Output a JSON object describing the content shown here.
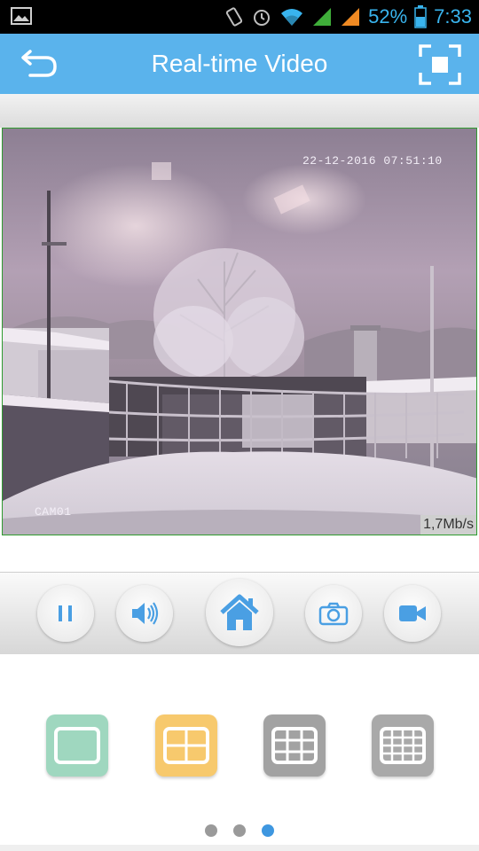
{
  "status_bar": {
    "battery": "52%",
    "time": "7:33",
    "icons": [
      "gallery-icon",
      "vibrate-icon",
      "alarm-icon",
      "wifi-icon",
      "signal-icon",
      "signal-icon",
      "battery-icon"
    ]
  },
  "header": {
    "title": "Real-time Video",
    "back_icon": "back-arrow-icon",
    "fullscreen_icon": "fullscreen-icon"
  },
  "video": {
    "timestamp": "22-12-2016 07:51:10",
    "camera_label": "CAM01",
    "bitrate": "1,7Mb/s"
  },
  "controls": [
    {
      "name": "pause-button",
      "icon": "pause-icon"
    },
    {
      "name": "audio-button",
      "icon": "speaker-icon"
    },
    {
      "name": "home-button",
      "icon": "home-icon"
    },
    {
      "name": "snapshot-button",
      "icon": "camera-icon"
    },
    {
      "name": "record-button",
      "icon": "video-camera-icon"
    }
  ],
  "layout_options": [
    {
      "name": "single-view",
      "color": "#9fd7bf"
    },
    {
      "name": "quad-view",
      "color": "#f7c96d"
    },
    {
      "name": "nine-view",
      "color": "#a2a2a2"
    },
    {
      "name": "sixteen-view",
      "color": "#a9a9a9"
    }
  ],
  "pager": {
    "pages": 3,
    "active": 3
  },
  "colors": {
    "accent": "#5ab3ec",
    "status_text": "#39b4ee",
    "icon_blue": "#4a9fe3"
  }
}
